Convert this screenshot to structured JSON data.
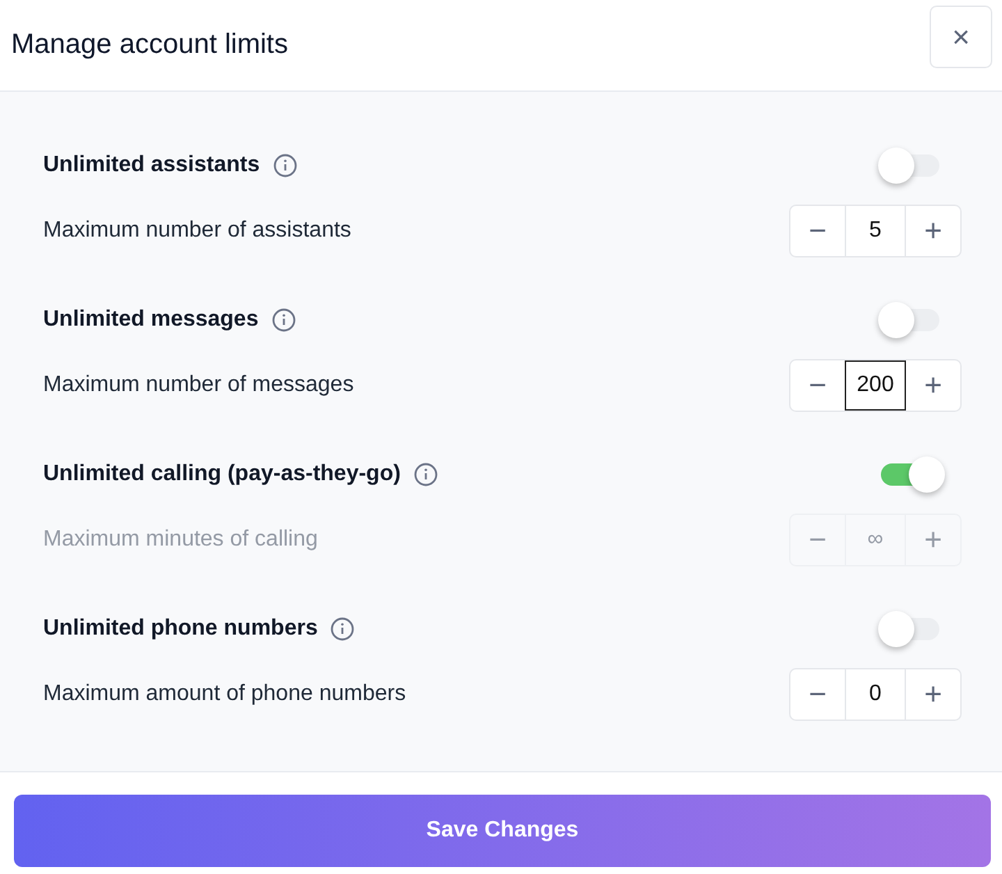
{
  "dialog": {
    "title": "Manage account limits",
    "close_label": "×"
  },
  "limits": [
    {
      "label": "Unlimited assistants",
      "unlimited": false,
      "field_label": "Maximum number of assistants",
      "minus": "−",
      "value": "5",
      "plus": "+",
      "disabled": false,
      "focused": false
    },
    {
      "label": "Unlimited messages",
      "unlimited": false,
      "field_label": "Maximum number of messages",
      "minus": "−",
      "value": "200",
      "plus": "+",
      "disabled": false,
      "focused": true
    },
    {
      "label": "Unlimited calling (pay-as-they-go)",
      "unlimited": true,
      "field_label": "Maximum minutes of calling",
      "minus": "−",
      "value": "∞",
      "plus": "+",
      "disabled": true,
      "focused": false
    },
    {
      "label": "Unlimited phone numbers",
      "unlimited": false,
      "field_label": "Maximum amount of phone numbers",
      "minus": "−",
      "value": "0",
      "plus": "+",
      "disabled": false,
      "focused": false
    }
  ],
  "save_button": "Save Changes"
}
